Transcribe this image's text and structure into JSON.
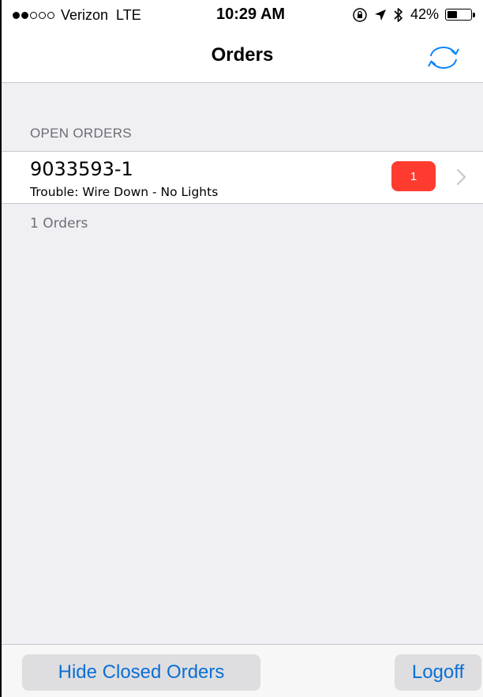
{
  "status_bar": {
    "carrier": "Verizon",
    "network": "LTE",
    "time": "10:29 AM",
    "battery_percent": "42%",
    "battery_level": 0.42,
    "signal_bars_filled": 2,
    "signal_bars_total": 5,
    "icons": [
      "orientation-lock-icon",
      "location-arrow-icon",
      "bluetooth-icon",
      "battery-icon"
    ]
  },
  "nav": {
    "title": "Orders",
    "refresh_icon": "refresh-icon",
    "accent_color": "#0a84ff"
  },
  "section": {
    "header": "OPEN ORDERS"
  },
  "orders": [
    {
      "id": "9033593-1",
      "description": "Trouble: Wire Down - No Lights",
      "badge": "1",
      "badge_color": "#ff3b30"
    }
  ],
  "summary": {
    "count_label": "1 Orders"
  },
  "toolbar": {
    "hide_closed_label": "Hide Closed Orders",
    "logoff_label": "Logoff",
    "button_text_color": "#0a6fd6"
  }
}
